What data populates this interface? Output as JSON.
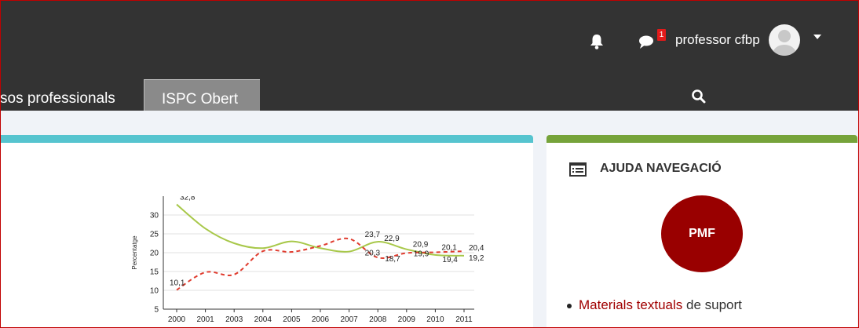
{
  "header": {
    "notifications_icon": "bell-icon",
    "messages_icon": "chat-bubble-icon",
    "messages_badge": "1",
    "user_name": "professor cfbp",
    "menu_icon": "caret-down-icon",
    "background": "#333333"
  },
  "nav": {
    "tabs": [
      {
        "label": "sos professionals"
      },
      {
        "label": "ISPC Obert"
      }
    ],
    "search_icon": "search-icon"
  },
  "main": {
    "accent": "#56c4cf",
    "chart_data": {
      "type": "line",
      "x": [
        "2000",
        "2001",
        "2003",
        "2004",
        "2005",
        "2006",
        "2007",
        "2008",
        "2009",
        "2010",
        "2011"
      ],
      "ylabel": "Percentatge",
      "ylim": [
        5,
        35
      ],
      "yticks": [
        "5",
        "10",
        "15",
        "20",
        "25",
        "30"
      ],
      "series": [
        {
          "style": "solid",
          "color": "#a8c84a",
          "values": [
            32.8,
            26.4,
            22.5,
            21.2,
            23.0,
            21.2,
            20.3,
            22.9,
            20.9,
            19.4,
            19.2
          ]
        },
        {
          "style": "dashed",
          "color": "#e03c2f",
          "values": [
            10.1,
            14.8,
            14.2,
            20.4,
            20.2,
            21.8,
            23.7,
            18.7,
            19.9,
            20.1,
            20.4
          ]
        }
      ],
      "data_labels": [
        "32,8",
        "10,1",
        "23,7",
        "20,3",
        "22,9",
        "18,7",
        "20,9",
        "19,9",
        "20,1",
        "19,4",
        "20,4",
        "19,2"
      ]
    }
  },
  "sidebar": {
    "accent": "#76a33a",
    "title": "AJUDA NAVEGACIÓ",
    "title_icon": "list-icon",
    "pmf_label": "PMF",
    "pmf_color": "#990000",
    "items": [
      {
        "link": "Materials textuals",
        "rest": " de suport"
      }
    ]
  }
}
